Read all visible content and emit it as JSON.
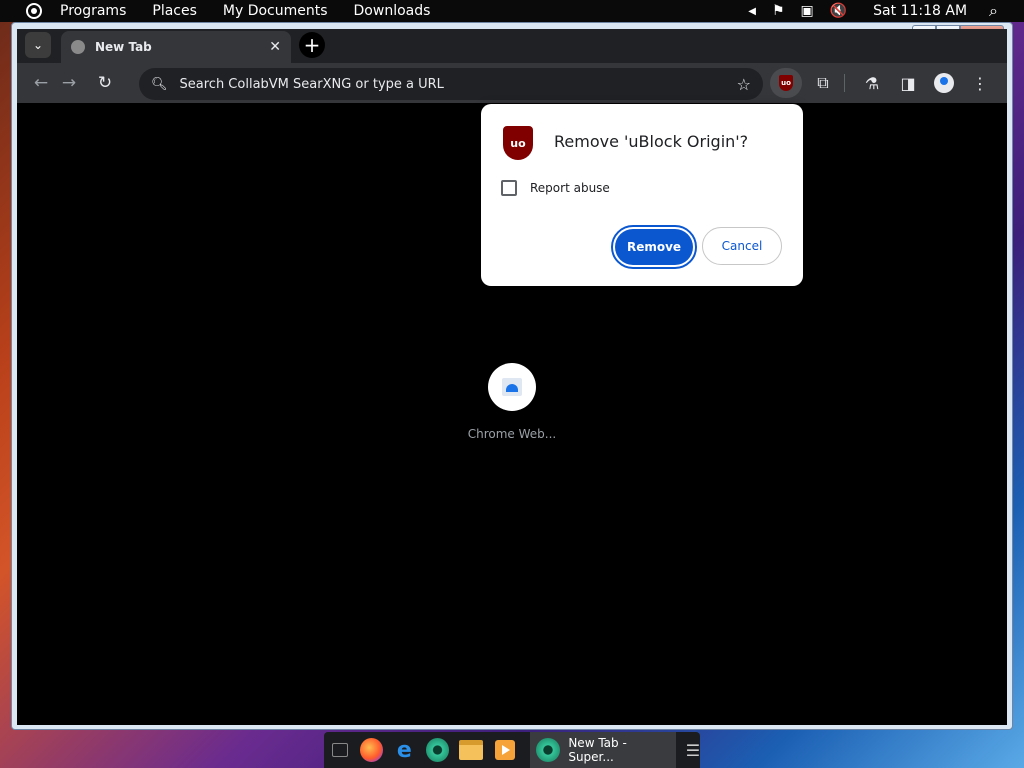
{
  "top_panel": {
    "menus": [
      "Programs",
      "Places",
      "My Documents",
      "Downloads"
    ],
    "clock": "Sat 11:18 AM"
  },
  "browser": {
    "tab_title": "New Tab",
    "omnibox_placeholder": "Search CollabVM SearXNG or type a URL",
    "shortcut_label": "Chrome Web..."
  },
  "dialog": {
    "title": "Remove 'uBlock Origin'?",
    "checkbox_label": "Report abuse",
    "remove_label": "Remove",
    "cancel_label": "Cancel",
    "logo_text": "uo"
  },
  "taskbar": {
    "active_task": "New Tab - Super..."
  },
  "colors": {
    "dialog_primary": "#0b57d0",
    "ublock_red": "#800000"
  }
}
